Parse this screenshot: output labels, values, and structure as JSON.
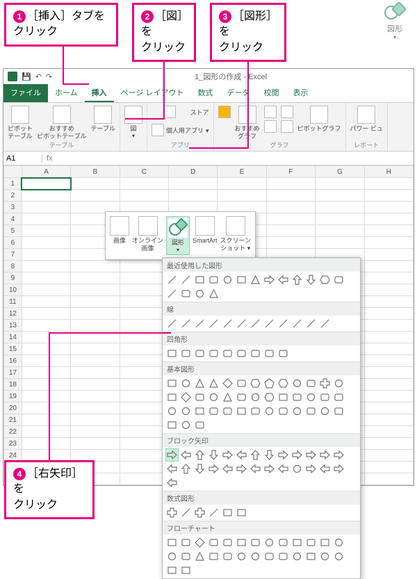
{
  "callouts": {
    "c1": {
      "num": "1",
      "text": "［挿入］タブを\nクリック"
    },
    "c2": {
      "num": "2",
      "text": "［図］を\nクリック"
    },
    "c3": {
      "num": "3",
      "text": "［図形］を\nクリック"
    },
    "c4": {
      "num": "4",
      "text": "［右矢印］を\nクリック"
    }
  },
  "shapesBig": {
    "label": "図形",
    "arrow": "▾"
  },
  "title": "1_図形の作成 - Excel",
  "qat": {
    "save": "💾",
    "undo": "↶",
    "redo": "↷"
  },
  "tabs": {
    "file": "ファイル",
    "home": "ホーム",
    "insert": "挿入",
    "layout": "ページ レイアウト",
    "formulas": "数式",
    "data": "データ",
    "review": "校閲",
    "view": "表示"
  },
  "ribbon": {
    "tables": {
      "pivot": "ピボット\nテーブル",
      "recpivot": "おすすめ\nピボットテーブル",
      "table": "テーブル",
      "group": "テーブル"
    },
    "illus": {
      "btn": "図",
      "group": ""
    },
    "apps": {
      "store": "ストア",
      "myapps": "個人用アプリ",
      "group": "アプリ"
    },
    "charts": {
      "rec": "おすすめ\nグラフ",
      "group": "グラフ",
      "pivotchart": "ピボットグラフ"
    },
    "reports": {
      "power": "パワー ビュー",
      "group": "レポート"
    }
  },
  "namebox": "A1",
  "columns": [
    "",
    "A",
    "B",
    "C",
    "D",
    "E",
    "F",
    "G",
    "H"
  ],
  "rows": 26,
  "illusPop": {
    "picture": "画像",
    "online": "オンライン\n画像",
    "shapes": "図形",
    "smartart": "SmartArt",
    "screenshot": "スクリーン\nショット"
  },
  "gallery": {
    "recent": "最近使用した図形",
    "lines": "線",
    "rects": "四角形",
    "basic": "基本図形",
    "block": "ブロック矢印",
    "equation": "数式図形",
    "flow": "フローチャート"
  }
}
